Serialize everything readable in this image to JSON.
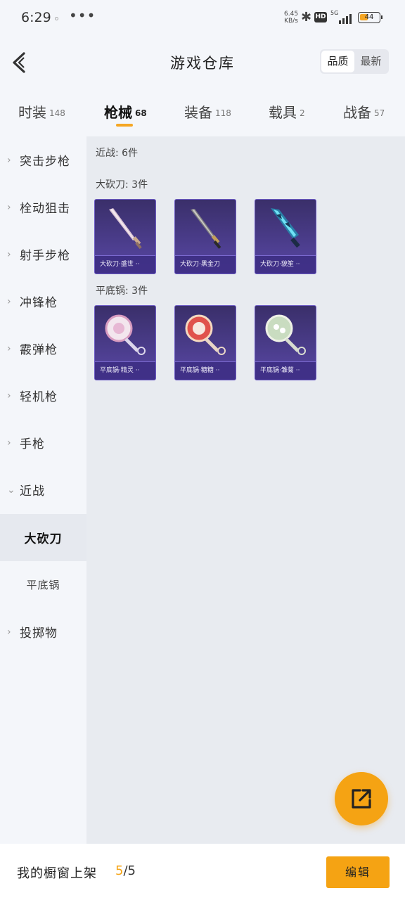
{
  "status_bar": {
    "time": "6:29",
    "more": "•••",
    "net_speed_value": "6.45",
    "net_speed_unit": "KB/s",
    "hd": "HD",
    "network": "5G",
    "battery": "44",
    "battery_level": 0.44,
    "accent": "#f5a623"
  },
  "header": {
    "title": "游戏仓库",
    "back_icon": "chevron-left-icon",
    "sort_options": [
      "品质",
      "最新"
    ],
    "sort_selected": "品质"
  },
  "tabs": [
    {
      "label": "时装",
      "count": "148"
    },
    {
      "label": "枪械",
      "count": "68",
      "active": true
    },
    {
      "label": "装备",
      "count": "118"
    },
    {
      "label": "载具",
      "count": "2"
    },
    {
      "label": "战备",
      "count": "57"
    }
  ],
  "sidebar": {
    "items": [
      {
        "label": "突击步枪",
        "arrow": "›"
      },
      {
        "label": "栓动狙击",
        "arrow": "›"
      },
      {
        "label": "射手步枪",
        "arrow": "›"
      },
      {
        "label": "冲锋枪",
        "arrow": "›"
      },
      {
        "label": "霰弹枪",
        "arrow": "›"
      },
      {
        "label": "轻机枪",
        "arrow": "›"
      },
      {
        "label": "手枪",
        "arrow": "›"
      },
      {
        "label": "近战",
        "arrow": "⌄"
      },
      {
        "label": "大砍刀",
        "selected": true
      },
      {
        "label": "平底锅"
      },
      {
        "label": "投掷物",
        "arrow": "›"
      }
    ]
  },
  "content": {
    "summary": "近战: 6件",
    "sections": [
      {
        "title": "大砍刀: 3件",
        "items": [
          {
            "label": "大砍刀·盛世 ··",
            "icon": "machete-icon"
          },
          {
            "label": "大砍刀·黑金刀",
            "icon": "machete-icon"
          },
          {
            "label": "大砍刀·貌笙 ··",
            "icon": "machete-icon"
          }
        ]
      },
      {
        "title": "平底锅: 3件",
        "items": [
          {
            "label": "平底锅·精灵 ··",
            "icon": "frying-pan-icon"
          },
          {
            "label": "平底锅·糖糖 ··",
            "icon": "frying-pan-icon"
          },
          {
            "label": "平底锅·雏菊 ··",
            "icon": "frying-pan-icon"
          }
        ]
      }
    ]
  },
  "fab": {
    "icon": "share-external-icon",
    "color": "#f5a313"
  },
  "bottom_bar": {
    "label": "我的橱窗上架",
    "count_current": "5",
    "count_total": "/5",
    "edit_label": "编辑"
  }
}
